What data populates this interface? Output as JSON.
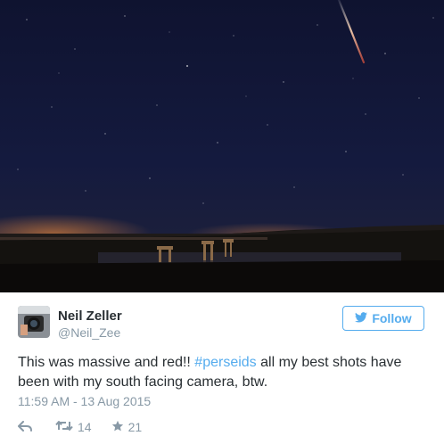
{
  "tweet": {
    "author_name": "Neil Zeller",
    "author_handle": "@Neil_Zee",
    "follow_label": "Follow",
    "text_before": "This was massive and red!! ",
    "hashtag": "#perseids",
    "text_after": "  all my best shots have been with my south facing camera, btw.",
    "timestamp": "11:59 AM - 13 Aug 2015",
    "retweet_count": "14",
    "favorite_count": "21"
  },
  "icons": {
    "reply": "reply-icon",
    "retweet": "retweet-icon",
    "favorite": "star-icon",
    "follow": "twitter-bird-icon"
  },
  "colors": {
    "accent": "#55acee",
    "text": "#292f33",
    "muted": "#8899a6"
  }
}
